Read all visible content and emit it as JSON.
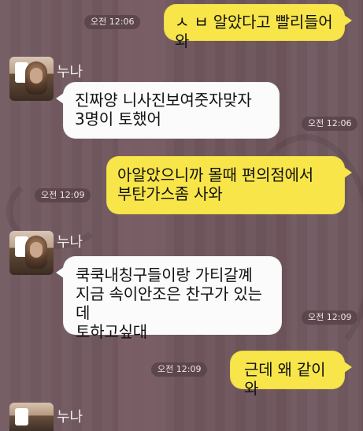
{
  "messages": [
    {
      "side": "right",
      "time": "오전 12:06",
      "text": "ㅅ ㅂ 알았다고 빨리들어와"
    },
    {
      "side": "left",
      "sender": "누나",
      "time": "오전 12:06",
      "text": "진짜양 니사진보여줏자맞자\n3명이 토했어"
    },
    {
      "side": "right",
      "time": "오전 12:09",
      "text": "아알았으니까 몰때 편의점에서\n부탄가스좀 사와"
    },
    {
      "side": "left",
      "sender": "누나",
      "time": "오전 12:09",
      "text": "쿡쿡내칭구들이랑 가티갈꼐\n지금 속이안조은 찬구가 있는데\n토하고싶대"
    },
    {
      "side": "right",
      "time": "오전 12:09",
      "text": "근데 왜 같이와"
    },
    {
      "side": "left",
      "sender": "누나",
      "partial": true
    }
  ],
  "colors": {
    "background": "#6f565d",
    "my_bubble": "#f7e54a",
    "other_bubble": "#fbfbfb",
    "time_badge": "#5d454d"
  }
}
